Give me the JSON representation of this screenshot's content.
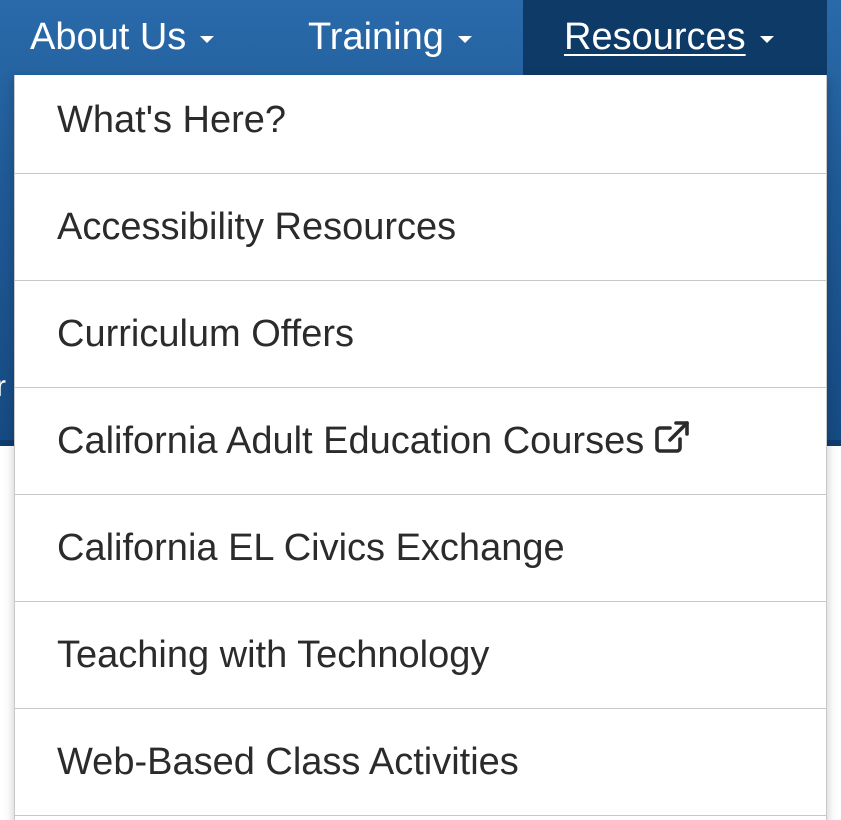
{
  "navbar": {
    "items": [
      {
        "label": "About Us",
        "has_caret": true,
        "active": false
      },
      {
        "label": "Training",
        "has_caret": true,
        "active": false
      },
      {
        "label": "Resources",
        "has_caret": true,
        "active": true
      }
    ]
  },
  "hero": {
    "fragment_text": "r"
  },
  "dropdown": {
    "items": [
      {
        "label": "What's Here?",
        "external": false
      },
      {
        "label": "Accessibility Resources",
        "external": false
      },
      {
        "label": "Curriculum Offers",
        "external": false
      },
      {
        "label": "California Adult Education Courses",
        "external": true,
        "icon": "external-link-icon"
      },
      {
        "label": "California EL Civics Exchange",
        "external": false
      },
      {
        "label": "Teaching with Technology",
        "external": false
      },
      {
        "label": "Web-Based Class Activities",
        "external": false
      }
    ]
  },
  "colors": {
    "nav_bg": "#1f5a96",
    "nav_active_bg": "#0d3a66",
    "menu_text": "#2b2b2b",
    "divider": "#c8c8c8"
  }
}
